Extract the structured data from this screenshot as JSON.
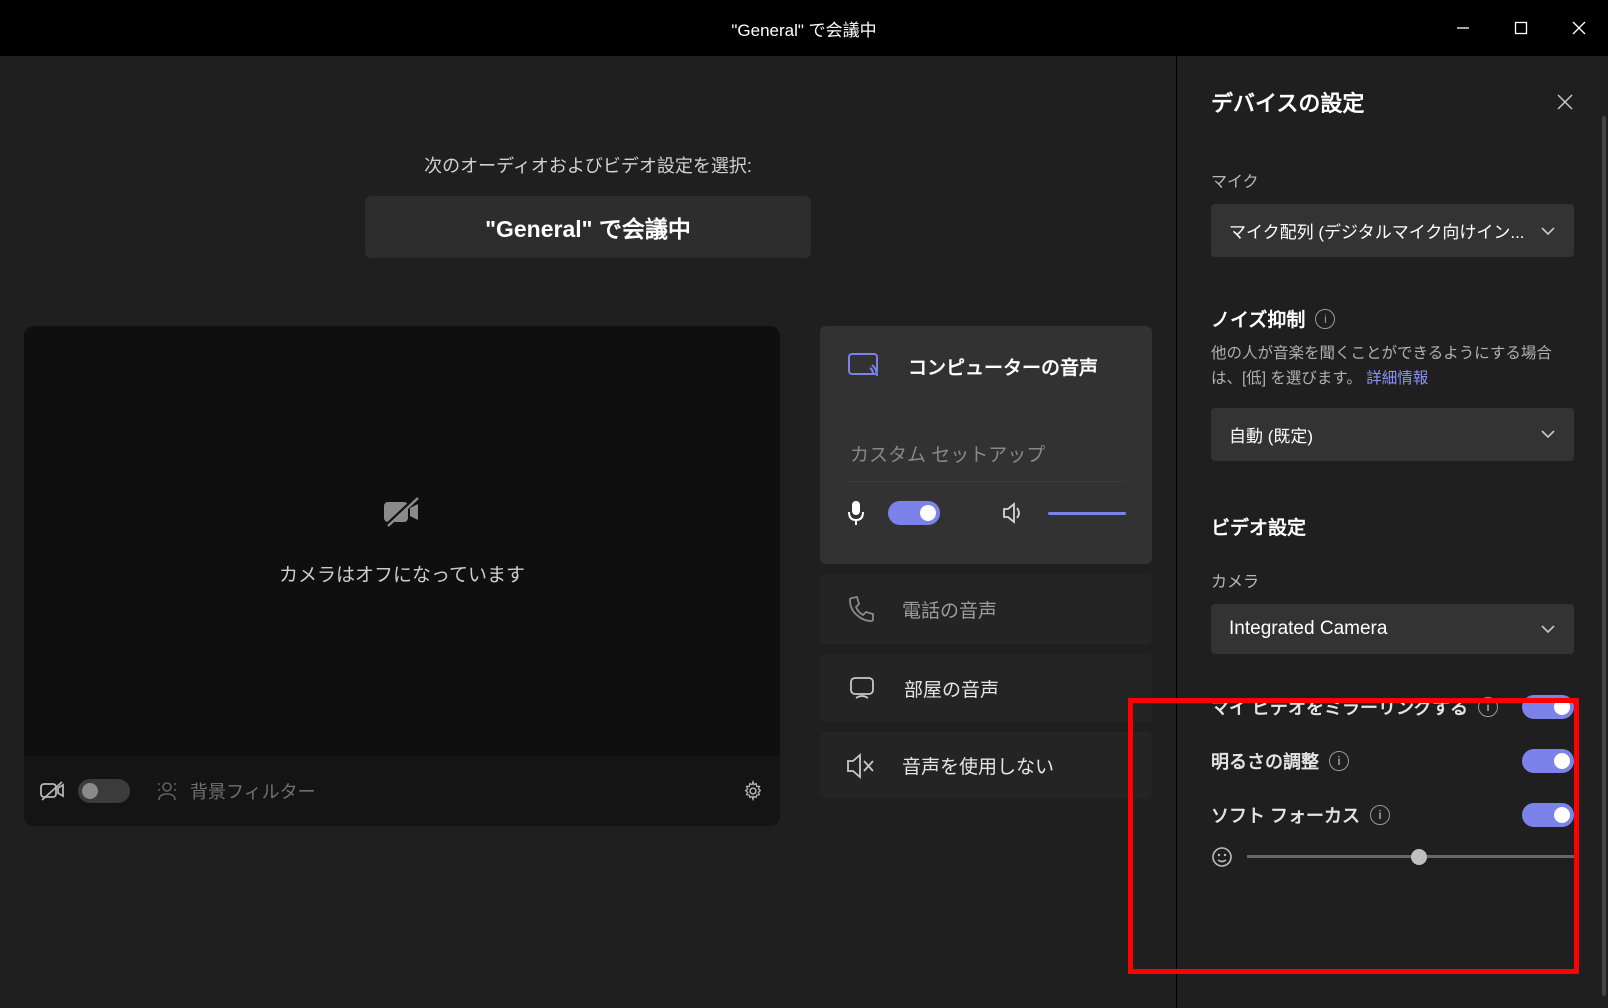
{
  "titlebar": {
    "title": "\"General\" で会議中"
  },
  "main": {
    "subtitle": "次のオーディオおよびビデオ設定を選択:",
    "meeting_title": "\"General\" で会議中",
    "preview": {
      "camera_off": "カメラはオフになっています"
    },
    "footer": {
      "bg_filter_placeholder": "背景フィルター"
    },
    "audio": {
      "computer": "コンピューターの音声",
      "custom_setup": "カスタム セットアップ",
      "phone": "電話の音声",
      "room": "部屋の音声",
      "none": "音声を使用しない"
    }
  },
  "panel": {
    "title": "デバイスの設定",
    "mic": {
      "label": "マイク",
      "selected": "マイク配列 (デジタルマイク向けイン..."
    },
    "noise": {
      "title": "ノイズ抑制",
      "help": "他の人が音楽を聞くことができるようにする場合は、[低] を選びます。 ",
      "link": "詳細情報",
      "selected": "自動 (既定)"
    },
    "video": {
      "title": "ビデオ設定",
      "camera_label": "カメラ",
      "camera_selected": "Integrated Camera",
      "mirror": "マイ ビデオをミラーリングする",
      "brightness": "明るさの調整",
      "soft_focus": "ソフト フォーカス"
    }
  }
}
